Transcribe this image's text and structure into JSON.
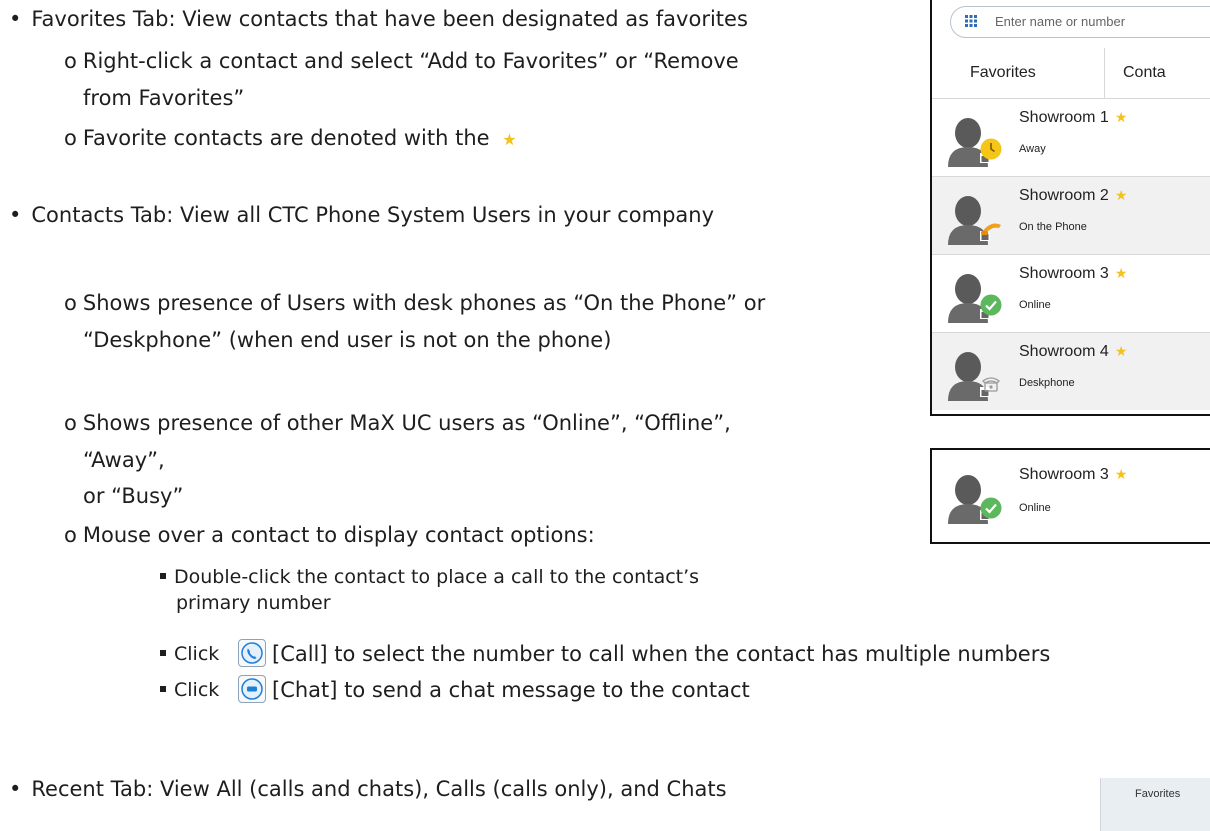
{
  "doc": {
    "line1": "Favorites Tab: View contacts that have been designated as favorites",
    "line2": "Right-click a contact and select “Add to Favorites” or “Remove",
    "line3": "from Favorites”",
    "line4": "Favorite contacts are denoted with the",
    "line5": "Contacts Tab: View all CTC Phone System Users in your company",
    "line6": "Shows presence of Users with desk phones as “On the Phone” or",
    "line7": "“Deskphone” (when end user is not on the phone)",
    "line8": "Shows presence of other MaX UC users as “Online”, “Offline”,",
    "line9": "“Away”,",
    "line10": "or “Busy”",
    "line11": "Mouse over a contact to display contact options:",
    "line12": "Double-click the contact to place a call to the contact’s",
    "line13": "primary number",
    "click_word": "Click",
    "line14_rest": "[Call] to select the number to call when the contact has multiple numbers",
    "line15_rest": "[Chat] to send a chat message to the contact",
    "line16": "Recent Tab: View All (calls and chats), Calls (calls only), and Chats",
    "bullet_dot": "•",
    "bullet_o": "o"
  },
  "app": {
    "search_placeholder": "Enter name or number",
    "tab_favorites": "Favorites",
    "tab_contacts": "Conta",
    "contacts": [
      {
        "name": "Showroom 1",
        "status": "Away"
      },
      {
        "name": "Showroom 2",
        "status": "On the Phone"
      },
      {
        "name": "Showroom 3",
        "status": "Online"
      },
      {
        "name": "Showroom 4",
        "status": "Deskphone"
      }
    ],
    "hover_contact": {
      "name": "Showroom 3",
      "status": "Online"
    },
    "corner_tab": "Favorites"
  },
  "colors": {
    "star": "#f3c21b",
    "away": "#f5c518",
    "online": "#5cb85c",
    "phone": "#f0a020",
    "button_blue": "#1f7fd6"
  }
}
